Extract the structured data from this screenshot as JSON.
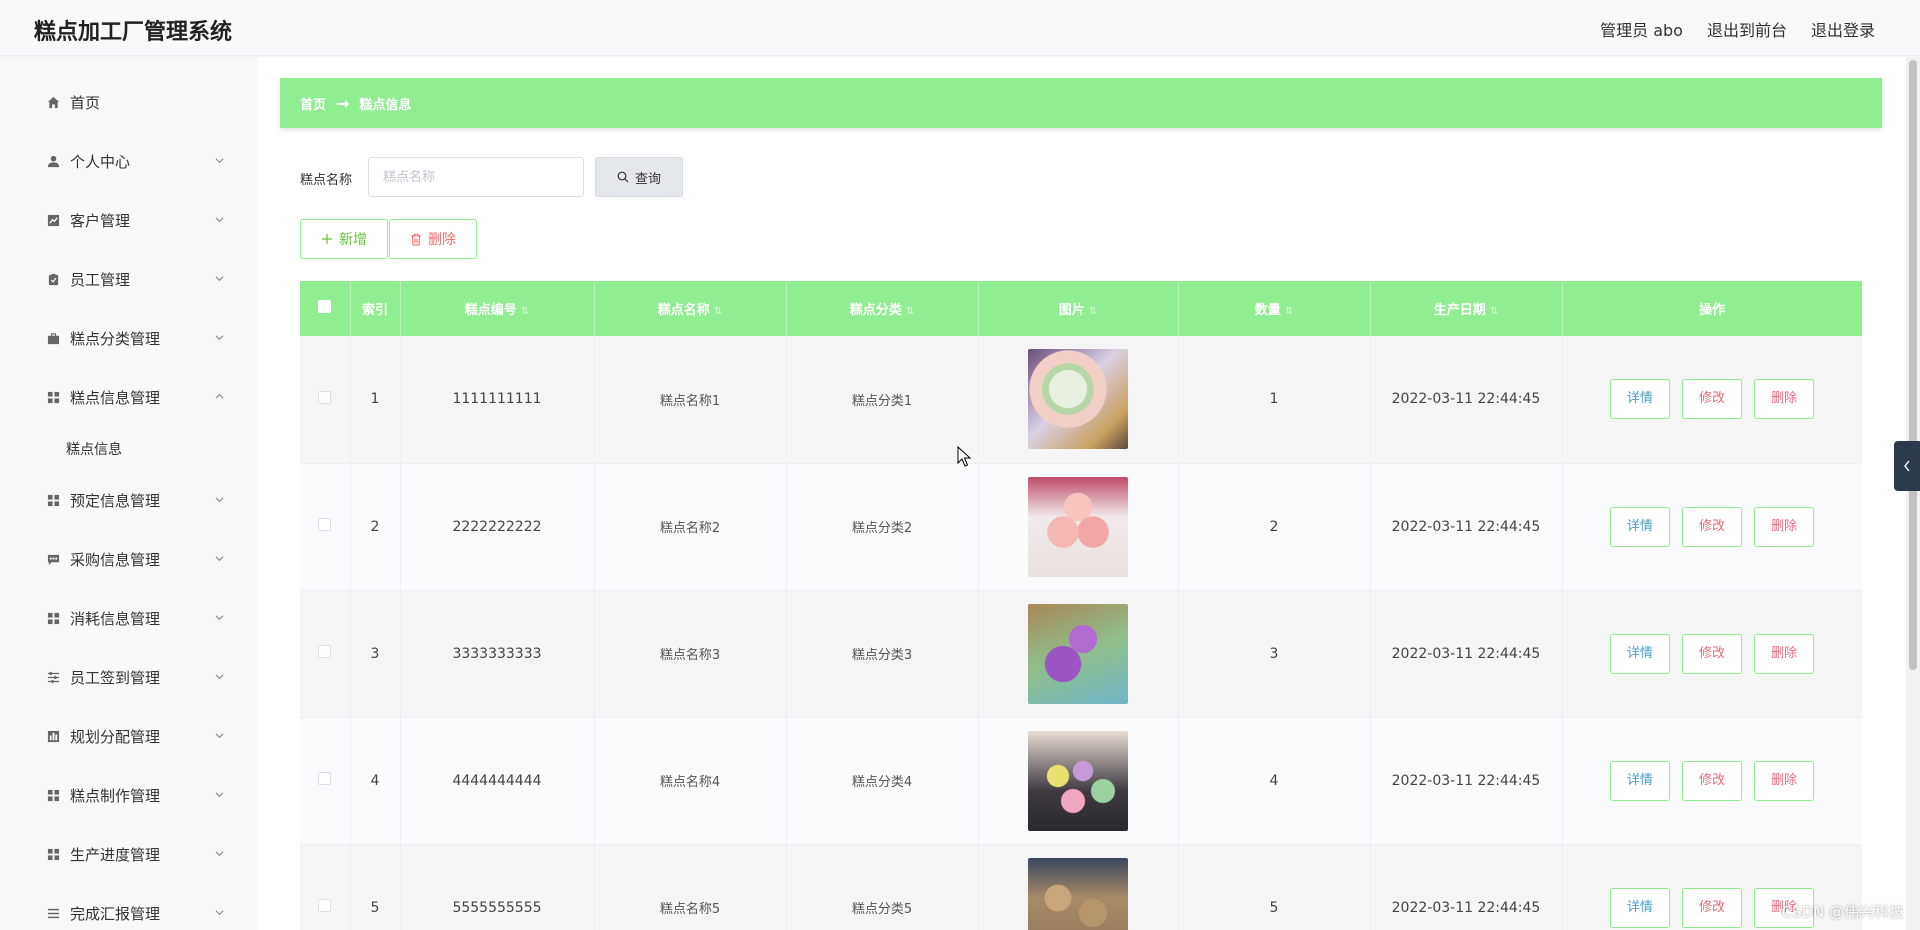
{
  "app": {
    "title": "糕点加工厂管理系统",
    "header_links": [
      "管理员 abo",
      "退出到前台",
      "退出登录"
    ]
  },
  "sidebar": {
    "items": [
      {
        "label": "首页",
        "icon": "home-icon",
        "has_children": false
      },
      {
        "label": "个人中心",
        "icon": "user-icon",
        "has_children": true
      },
      {
        "label": "客户管理",
        "icon": "chart-icon",
        "has_children": true
      },
      {
        "label": "员工管理",
        "icon": "clipboard-icon",
        "has_children": true
      },
      {
        "label": "糕点分类管理",
        "icon": "briefcase-icon",
        "has_children": true
      },
      {
        "label": "糕点信息管理",
        "icon": "grid-icon",
        "has_children": true,
        "expanded": true,
        "children": [
          "糕点信息"
        ]
      },
      {
        "label": "预定信息管理",
        "icon": "grid-icon",
        "has_children": true
      },
      {
        "label": "采购信息管理",
        "icon": "message-icon",
        "has_children": true
      },
      {
        "label": "消耗信息管理",
        "icon": "grid-icon",
        "has_children": true
      },
      {
        "label": "员工签到管理",
        "icon": "sliders-icon",
        "has_children": true
      },
      {
        "label": "规划分配管理",
        "icon": "bar-chart-icon",
        "has_children": true
      },
      {
        "label": "糕点制作管理",
        "icon": "grid-icon",
        "has_children": true
      },
      {
        "label": "生产进度管理",
        "icon": "grid-icon",
        "has_children": true
      },
      {
        "label": "完成汇报管理",
        "icon": "list-icon",
        "has_children": true
      }
    ]
  },
  "breadcrumb": {
    "home": "首页",
    "arrow": "→",
    "current": "糕点信息"
  },
  "search": {
    "label": "糕点名称",
    "placeholder": "糕点名称",
    "button": "查询"
  },
  "actions": {
    "add": "新增",
    "delete": "删除"
  },
  "table": {
    "columns": [
      "索引",
      "糕点编号",
      "糕点名称",
      "糕点分类",
      "图片",
      "数量",
      "生产日期",
      "操作"
    ],
    "rows": [
      {
        "index": "1",
        "code": "1111111111",
        "name": "糕点名称1",
        "category": "糕点分类1",
        "quantity": "1",
        "date": "2022-03-11 22:44:45"
      },
      {
        "index": "2",
        "code": "2222222222",
        "name": "糕点名称2",
        "category": "糕点分类2",
        "quantity": "2",
        "date": "2022-03-11 22:44:45"
      },
      {
        "index": "3",
        "code": "3333333333",
        "name": "糕点名称3",
        "category": "糕点分类3",
        "quantity": "3",
        "date": "2022-03-11 22:44:45"
      },
      {
        "index": "4",
        "code": "4444444444",
        "name": "糕点名称4",
        "category": "糕点分类4",
        "quantity": "4",
        "date": "2022-03-11 22:44:45"
      },
      {
        "index": "5",
        "code": "5555555555",
        "name": "糕点名称5",
        "category": "糕点分类5",
        "quantity": "5",
        "date": "2022-03-11 22:44:45"
      }
    ],
    "row_actions": {
      "detail": "详情",
      "edit": "修改",
      "delete": "删除"
    }
  },
  "watermark": "CSDN @伟兴科技",
  "colors": {
    "accent": "#90ee90",
    "danger": "#f56c6c",
    "detail": "#4ba0c8"
  }
}
